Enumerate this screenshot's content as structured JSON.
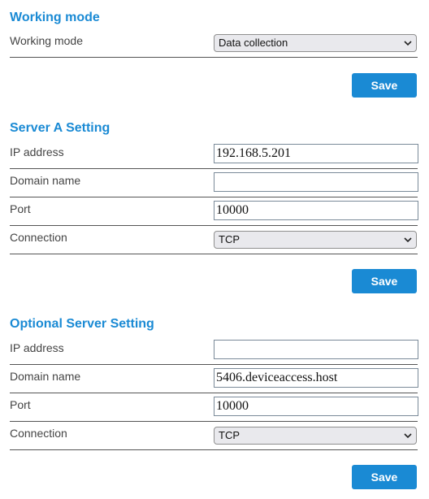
{
  "working_mode": {
    "title": "Working mode",
    "mode_label": "Working mode",
    "mode_value": "Data collection",
    "save_label": "Save"
  },
  "server_a": {
    "title": "Server A Setting",
    "ip_label": "IP address",
    "ip_value": "192.168.5.201",
    "domain_label": "Domain name",
    "domain_value": "",
    "port_label": "Port",
    "port_value": "10000",
    "connection_label": "Connection",
    "connection_value": "TCP",
    "save_label": "Save"
  },
  "optional_server": {
    "title": "Optional Server Setting",
    "ip_label": "IP address",
    "ip_value": "",
    "domain_label": "Domain name",
    "domain_value": "5406.deviceaccess.host",
    "port_label": "Port",
    "port_value": "10000",
    "connection_label": "Connection",
    "connection_value": "TCP",
    "save_label": "Save"
  },
  "colors": {
    "accent": "#1a8ad4",
    "text": "#444444",
    "divider": "#555555"
  }
}
